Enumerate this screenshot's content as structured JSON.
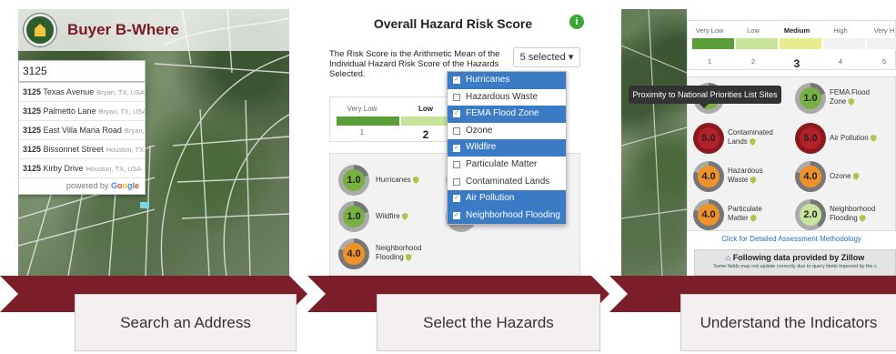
{
  "panel1": {
    "app_title": "Buyer B-Where",
    "search_value": "3125",
    "suggestions": [
      {
        "street": "3125",
        "rest": " Texas Avenue",
        "city": "Bryan, TX, USA"
      },
      {
        "street": "3125",
        "rest": " Palmetto Lane",
        "city": "Bryan, TX, USA"
      },
      {
        "street": "3125",
        "rest": " East Villa Maria Road",
        "city": "Bryan,..."
      },
      {
        "street": "3125",
        "rest": " Bissonnet Street",
        "city": "Houston, TX..."
      },
      {
        "street": "3125",
        "rest": " Kirby Drive",
        "city": "Houston, TX, USA"
      }
    ],
    "powered_by": "powered by"
  },
  "panel2": {
    "title": "Overall Hazard Risk Score",
    "info": "i",
    "description": "The Risk Score is the Arithmetic Mean of the Individual Hazard Risk Score of the Hazards Selected.",
    "selected_label": "5 selected ▾",
    "scale_labels": [
      "Very Low",
      "Low",
      "Me"
    ],
    "scale_numbers": [
      "1",
      "2",
      ""
    ],
    "dropdown": [
      {
        "label": "Hurricanes",
        "checked": true
      },
      {
        "label": "Hazardous Waste",
        "checked": false
      },
      {
        "label": "FEMA Flood Zone",
        "checked": true
      },
      {
        "label": "Ozone",
        "checked": false
      },
      {
        "label": "Wildfire",
        "checked": true
      },
      {
        "label": "Particulate Matter",
        "checked": false
      },
      {
        "label": "Contaminated Lands",
        "checked": false
      },
      {
        "label": "Air Pollution",
        "checked": true
      },
      {
        "label": "Neighborhood Flooding",
        "checked": true
      }
    ],
    "indicators": [
      {
        "score": "1.0",
        "label1": "Hurricanes",
        "label2": ""
      },
      {
        "score": "1.0",
        "label1": "Wildfire",
        "label2": ""
      },
      {
        "score": "4.0",
        "label1": "Neighborhood",
        "label2": "Flooding"
      }
    ]
  },
  "panel3": {
    "scale_labels": [
      "Very Low",
      "Low",
      "Medium",
      "High",
      "Very H"
    ],
    "scale_numbers": [
      "1",
      "2",
      "3",
      "4",
      "5"
    ],
    "tooltip": "Proximity to National Priorities List Sites",
    "indicators": [
      {
        "score": "1.0",
        "label1": "FEMA Flood",
        "label2": "Zone"
      },
      {
        "score": "5.0",
        "label1": "Contaminated",
        "label2": "Lands"
      },
      {
        "score": "5.0",
        "label1": "Air Pollution",
        "label2": ""
      },
      {
        "score": "4.0",
        "label1": "Hazardous",
        "label2": "Waste"
      },
      {
        "score": "4.0",
        "label1": "Ozone",
        "label2": ""
      },
      {
        "score": "4.0",
        "label1": "Particulate",
        "label2": "Matter"
      },
      {
        "score": "2.0",
        "label1": "Neighborhood",
        "label2": "Flooding"
      }
    ],
    "methodology_link": "Click for Detailed Assessment Methodology",
    "zillow_title": "Following data provided by Zillow",
    "zillow_note": "Some fields may not update correctly due to query limits imposed by the c"
  },
  "steps": [
    "Search an Address",
    "Select the Hazards",
    "Understand the Indicators"
  ],
  "colors": {
    "maroon": "#7b1e29",
    "scale": [
      "#5a9e3a",
      "#c6e39a",
      "#e7ec8e",
      "#f1f1f1",
      "#f1f1f1"
    ],
    "score_green": "#77b043",
    "score_lightgreen": "#c8e39b",
    "score_orange": "#f0922a",
    "score_red": "#b3212a",
    "selected_blue": "#3b7bc6"
  }
}
